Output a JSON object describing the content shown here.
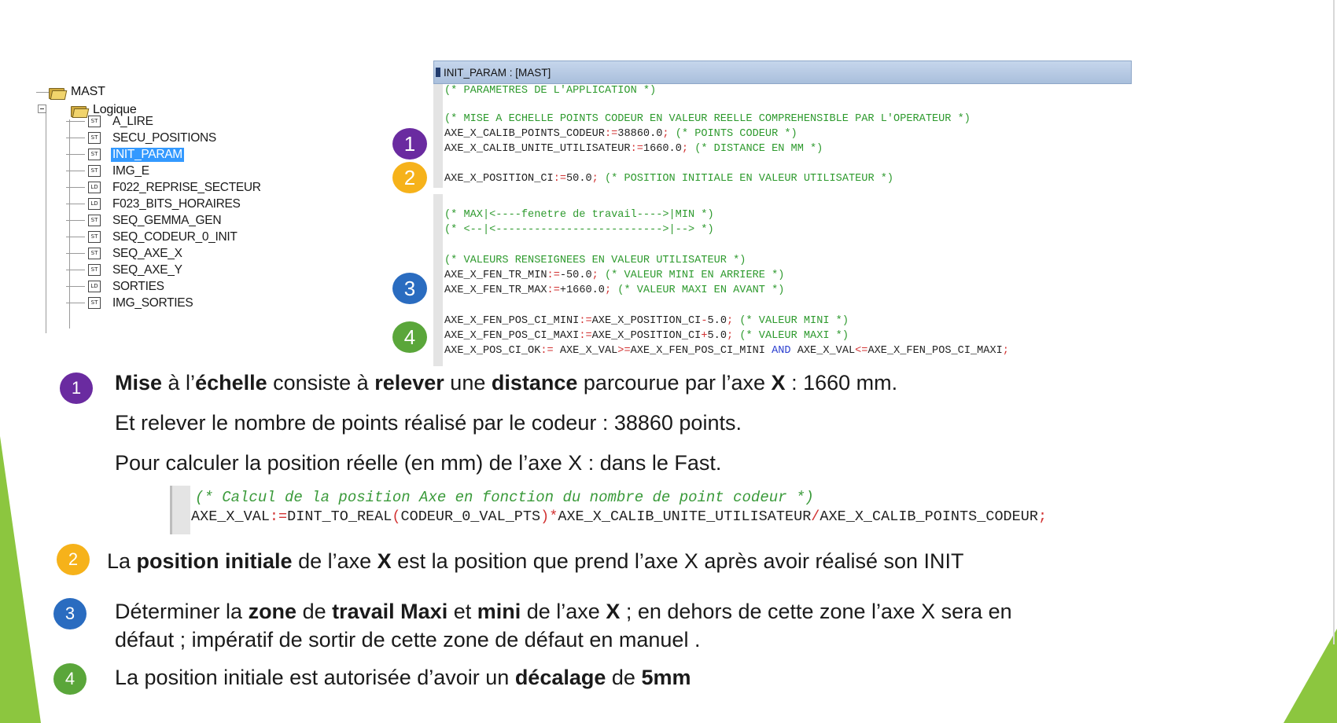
{
  "tree": {
    "root": "MAST",
    "folder": "Logique",
    "items": [
      {
        "icon": "ST",
        "label": "A_LIRE"
      },
      {
        "icon": "ST",
        "label": "SECU_POSITIONS"
      },
      {
        "icon": "ST",
        "label": "INIT_PARAM",
        "selected": true
      },
      {
        "icon": "ST",
        "label": "IMG_E"
      },
      {
        "icon": "LD",
        "label": "F022_REPRISE_SECTEUR"
      },
      {
        "icon": "LD",
        "label": "F023_BITS_HORAIRES"
      },
      {
        "icon": "ST",
        "label": "SEQ_GEMMA_GEN"
      },
      {
        "icon": "ST",
        "label": "SEQ_CODEUR_0_INIT"
      },
      {
        "icon": "ST",
        "label": "SEQ_AXE_X"
      },
      {
        "icon": "ST",
        "label": "SEQ_AXE_Y"
      },
      {
        "icon": "LD",
        "label": "SORTIES"
      },
      {
        "icon": "ST",
        "label": "IMG_SORTIES"
      }
    ]
  },
  "code_window": {
    "title": "INIT_PARAM : [MAST]",
    "lines": {
      "l1": {
        "c": "(* PARAMETRES DE L'APPLICATION *)"
      },
      "l2": {
        "c": "(* MISE A ECHELLE POINTS CODEUR EN VALEUR REELLE COMPREHENSIBLE PAR L'OPERATEUR *)"
      },
      "l3": {
        "a": "AXE_X_CALIB_POINTS_CODEUR",
        "b": ":=",
        "d": "38860.0",
        "e": ";",
        "c": " (* POINTS CODEUR *)"
      },
      "l4": {
        "a": "AXE_X_CALIB_UNITE_UTILISATEUR",
        "b": ":=",
        "d": "1660.0",
        "e": ";",
        "c": " (* DISTANCE EN MM *)"
      },
      "l5": {
        "a": "AXE_X_POSITION_CI",
        "b": ":=",
        "d": "50.0",
        "e": ";",
        "c": " (* POSITION INITIALE EN VALEUR UTILISATEUR *)"
      },
      "l6": {
        "c": "(* MAX|<----fenetre de travail---->|MIN *)"
      },
      "l7": {
        "c": "(* <--|<-------------------------->|--> *)"
      },
      "l8": {
        "c": "(* VALEURS RENSEIGNEES EN VALEUR UTILISATEUR *)"
      },
      "l9": {
        "a": "AXE_X_FEN_TR_MIN",
        "b": ":=",
        "d": "-50.0",
        "e": ";",
        "c": " (* VALEUR MINI EN ARRIERE *)"
      },
      "l10": {
        "a": "AXE_X_FEN_TR_MAX",
        "b": ":=",
        "d": "+1660.0",
        "e": ";",
        "c": " (* VALEUR MAXI EN AVANT *)"
      },
      "l11": {
        "a": "AXE_X_FEN_POS_CI_MINI",
        "b": ":=",
        "f": "AXE_X_POSITION_CI",
        "g": "-",
        "d": "5.0",
        "e": ";",
        "c": " (* VALEUR MINI *)"
      },
      "l12": {
        "a": "AXE_X_FEN_POS_CI_MAXI",
        "b": ":=",
        "f": "AXE_X_POSITION_CI",
        "g": "+",
        "d": "5.0",
        "e": ";",
        "c": " (* VALEUR MAXI *)"
      },
      "l13": {
        "a": "AXE_X_POS_CI_OK",
        "b": ":=",
        "p1": " AXE_X_VAL",
        "o1": ">=",
        "p2": "AXE_X_FEN_POS_CI_MINI ",
        "kw": "AND",
        "p3": " AXE_X_VAL",
        "o2": "<=",
        "p4": "AXE_X_FEN_POS_CI_MAXI",
        "e": ";"
      }
    }
  },
  "badges": {
    "n1": "1",
    "n2": "2",
    "n3": "3",
    "n4": "4"
  },
  "colors": {
    "purple": "#6a2ba0",
    "yellow": "#f6b21a",
    "blue": "#2a6cc0",
    "green": "#5aa63a",
    "accent_green": "#8cc63f"
  },
  "text": {
    "p1": {
      "b1": "Mise",
      "t1": " à l’",
      "b2": "échelle",
      "t2": " consiste à ",
      "b3": "relever",
      "t3": " une ",
      "b4": "distance",
      "t4": " parcourue par l’axe ",
      "b5": "X",
      "t5": " : 1660 mm."
    },
    "p1b": "Et relever le nombre de points réalisé par le codeur : 38860 points.",
    "p1c": "Pour calculer la position réelle (en mm) de l’axe X : dans le Fast.",
    "fast": {
      "comment": "(* Calcul de la position Axe en fonction du nombre de point codeur *)",
      "a": "AXE_X_VAL",
      "b": ":=",
      "c": "DINT_TO_REAL",
      "d": "(",
      "e": "CODEUR_0_VAL_PTS",
      "f": ")",
      "g": "*",
      "h": "AXE_X_CALIB_UNITE_UTILISATEUR",
      "i": "/",
      "j": "AXE_X_CALIB_POINTS_CODEUR",
      "k": ";"
    },
    "p2": {
      "t1": "La ",
      "b1": "position initiale",
      "t2": " de l’axe ",
      "b2": "X",
      "t3": " est la position que prend l’axe X après avoir réalisé son INIT"
    },
    "p3": {
      "t1": "Déterminer la ",
      "b1": "zone",
      "t2": " de ",
      "b2": "travail Maxi",
      "t3": " et ",
      "b3": "mini",
      "t4": " de l’axe ",
      "b4": "X",
      "t5": " ; en dehors de cette zone l’axe X sera en"
    },
    "p3b": "défaut ; impératif de sortir de cette zone de défaut en manuel .",
    "p4": {
      "t1": "La position initiale est autorisée d’avoir un ",
      "b1": "décalage",
      "t2": " de ",
      "b2": "5mm"
    }
  }
}
